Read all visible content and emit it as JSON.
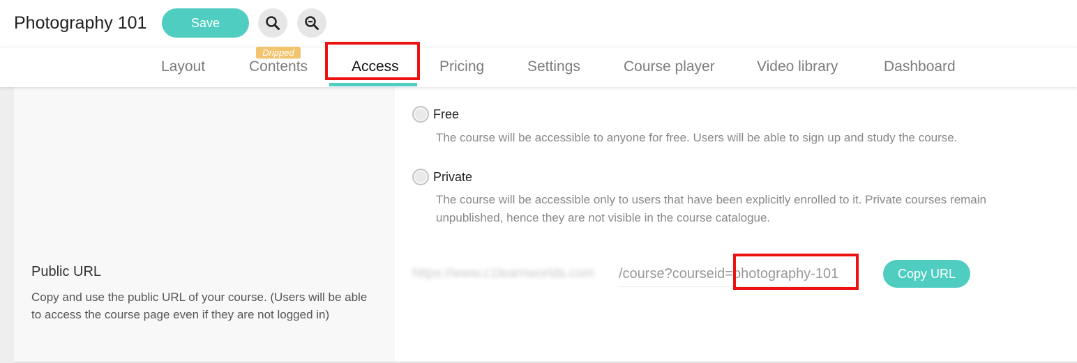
{
  "header": {
    "course_title": "Photography 101",
    "save_label": "Save",
    "search_icon": "search-icon",
    "zoom_out_icon": "zoom-out-icon"
  },
  "tabs": [
    {
      "label": "Layout",
      "active": false
    },
    {
      "label": "Contents",
      "active": false,
      "badge": "Dripped"
    },
    {
      "label": "Access",
      "active": true
    },
    {
      "label": "Pricing",
      "active": false
    },
    {
      "label": "Settings",
      "active": false
    },
    {
      "label": "Course player",
      "active": false
    },
    {
      "label": "Video library",
      "active": false
    },
    {
      "label": "Dashboard",
      "active": false
    }
  ],
  "access": {
    "options": [
      {
        "label": "Free",
        "description": "The course will be accessible to anyone for free. Users will be able to sign up and study the course.",
        "selected": false
      },
      {
        "label": "Private",
        "description": "The course will be accessible only to users that have been explicitly enrolled to it. Private courses remain unpublished, hence they are not visible in the course catalogue.",
        "selected": false
      }
    ]
  },
  "public_url": {
    "title": "Public URL",
    "description": "Copy and use the public URL of your course. (Users will be able to access the course page even if they are not logged in)",
    "url_path": "/course?courseid=",
    "course_id": "photography-101",
    "copy_label": "Copy URL"
  },
  "colors": {
    "accent": "#4fcdc1",
    "highlight_box": "#ee1111",
    "badge": "#f2c46d"
  }
}
